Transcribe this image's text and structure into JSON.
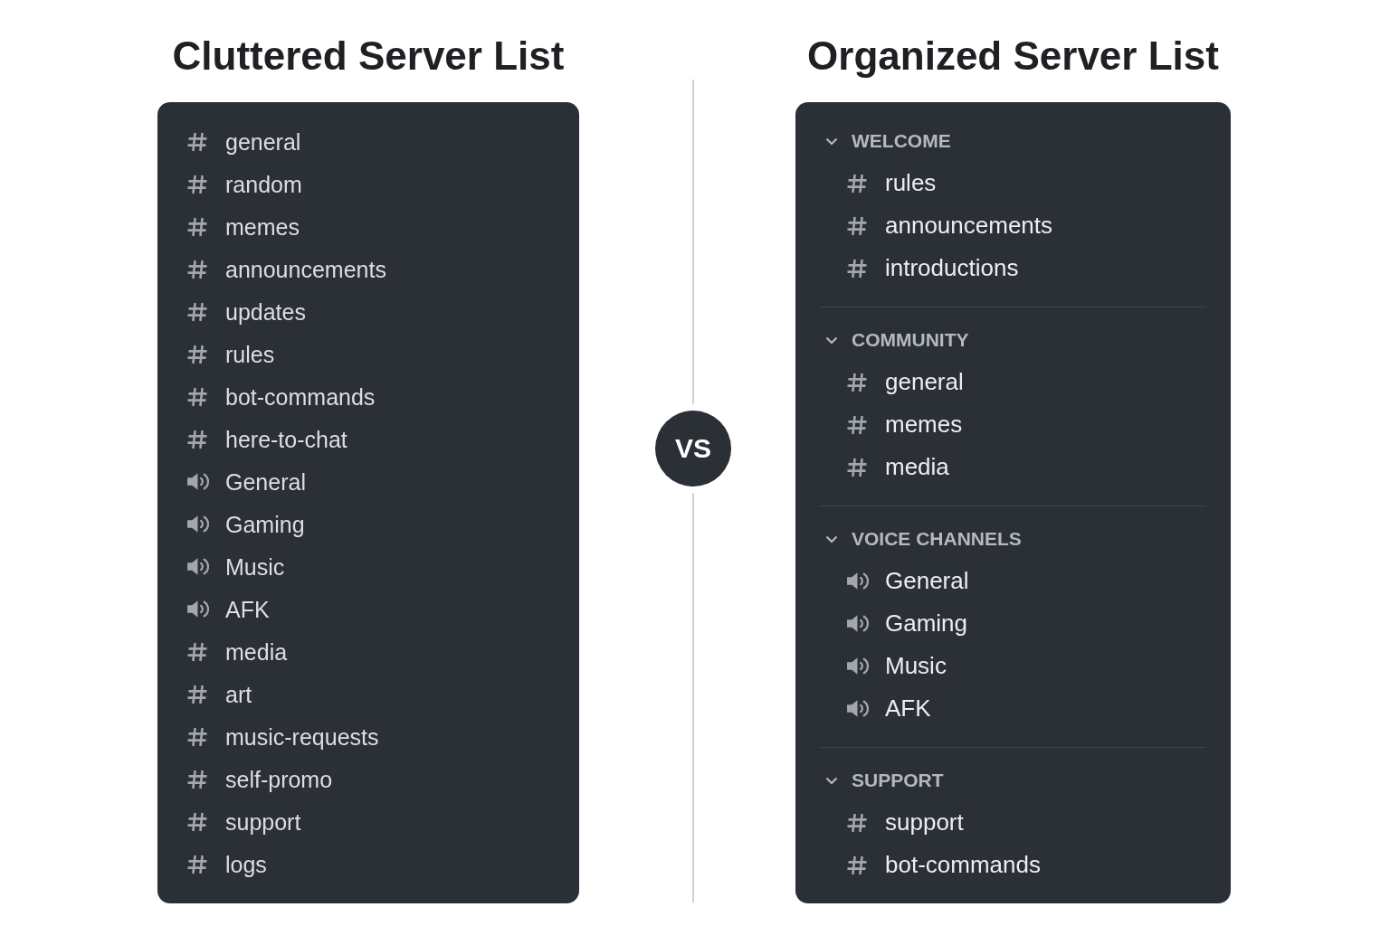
{
  "cluttered": {
    "title": "Cluttered Server List",
    "channels": [
      {
        "kind": "text",
        "name": "general"
      },
      {
        "kind": "text",
        "name": "random"
      },
      {
        "kind": "text",
        "name": "memes"
      },
      {
        "kind": "text",
        "name": "announcements"
      },
      {
        "kind": "text",
        "name": "updates"
      },
      {
        "kind": "text",
        "name": "rules"
      },
      {
        "kind": "text",
        "name": "bot-commands"
      },
      {
        "kind": "text",
        "name": "here-to-chat"
      },
      {
        "kind": "voice",
        "name": "General"
      },
      {
        "kind": "voice",
        "name": "Gaming"
      },
      {
        "kind": "voice",
        "name": "Music"
      },
      {
        "kind": "voice",
        "name": "AFK"
      },
      {
        "kind": "text",
        "name": "media"
      },
      {
        "kind": "text",
        "name": "art"
      },
      {
        "kind": "text",
        "name": "music-requests"
      },
      {
        "kind": "text",
        "name": "self-promo"
      },
      {
        "kind": "text",
        "name": "support"
      },
      {
        "kind": "text",
        "name": "logs"
      }
    ]
  },
  "versus": "VS",
  "organized": {
    "title": "Organized Server List",
    "categories": [
      {
        "name": "WELCOME",
        "expanded": true,
        "channels": [
          {
            "kind": "text",
            "name": "rules"
          },
          {
            "kind": "text",
            "name": "announcements"
          },
          {
            "kind": "text",
            "name": "introductions"
          }
        ]
      },
      {
        "name": "COMMUNITY",
        "expanded": true,
        "channels": [
          {
            "kind": "text",
            "name": "general"
          },
          {
            "kind": "text",
            "name": "memes"
          },
          {
            "kind": "text",
            "name": "media"
          }
        ]
      },
      {
        "name": "VOICE CHANNELS",
        "expanded": true,
        "channels": [
          {
            "kind": "voice",
            "name": "General"
          },
          {
            "kind": "voice",
            "name": "Gaming"
          },
          {
            "kind": "voice",
            "name": "Music"
          },
          {
            "kind": "voice",
            "name": "AFK"
          }
        ]
      },
      {
        "name": "SUPPORT",
        "expanded": true,
        "channels": [
          {
            "kind": "text",
            "name": "support"
          },
          {
            "kind": "text",
            "name": "bot-commands"
          }
        ]
      }
    ]
  }
}
